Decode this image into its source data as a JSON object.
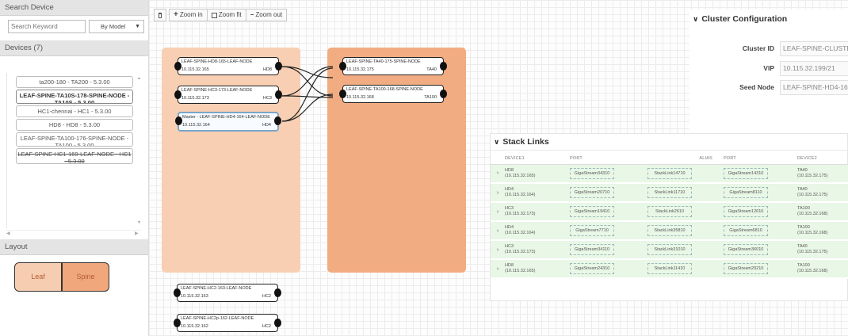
{
  "left_panel": {
    "search_header": "Search Device",
    "search_placeholder": "Search Keyword",
    "model_select": "By Model",
    "devices_header": "Devices (7)",
    "devices": [
      "ta200-180 - TA200 - 5.3.00",
      "LEAF-SPINE-TA10S-178-SPINE-NODE - TA10S - 5.3.00",
      "HC1-chennai - HC1 - 5.3.00",
      "HD8 - HD8 - 5.3.00",
      "LEAF-SPINE-TA100-176-SPINE-NODE - TA100 - 5.3.00",
      "LEAF-SPINE-HC1-169-LEAF-NODE - HC1 - 5.3.00"
    ],
    "layout_header": "Layout",
    "legend": {
      "leaf": "Leaf",
      "spine": "Spine"
    }
  },
  "toolbar": {
    "zoom_in": "Zoom in",
    "zoom_fit": "Zoom fit",
    "zoom_out": "Zoom out"
  },
  "topology": {
    "leaf_nodes": [
      {
        "name": "LEAF-SPINE-HD8-165-LEAF-NODE",
        "ip": "10.115.32.165",
        "model": "HD8"
      },
      {
        "name": "LEAF-SPINE-HC3-173-LEAF-NODE",
        "ip": "10.115.32.173",
        "model": "HC3"
      },
      {
        "name": "Master - LEAF-SPINE-HD4-164-LEAF-NODE",
        "ip": "10.115.32.164",
        "model": "HD4"
      }
    ],
    "spine_nodes": [
      {
        "name": "LEAF-SPINE-TA40-175-SPINE-NODE",
        "ip": "10.115.32.175",
        "model": "TA40"
      },
      {
        "name": "LEAF-SPINE-TA100-168-SPINE-NODE",
        "ip": "10.115.32.168",
        "model": "TA100"
      }
    ],
    "unassigned_nodes": [
      {
        "name": "LEAF-SPINE-HC2-163-LEAF-NODE",
        "ip": "10.115.32.163",
        "model": "HC2"
      },
      {
        "name": "LEAF-SPINE-HC2p-162-LEAF-NODE",
        "ip": "10.115.32.162",
        "model": "HC2"
      }
    ]
  },
  "cluster_config": {
    "title": "Cluster Configuration",
    "cluster_id_label": "Cluster ID",
    "cluster_id": "LEAF-SPINE-CLUSTER-",
    "vip_label": "VIP",
    "vip": "10.115.32.199/21",
    "seed_node_label": "Seed Node",
    "seed_node": "LEAF-SPINE-HD4-164-"
  },
  "stack_links": {
    "title": "Stack Links",
    "columns": [
      "DEVICE1",
      "PORT",
      "ALIAS",
      "PORT",
      "DEVICE2"
    ],
    "rows": [
      {
        "d1": "HD8",
        "d1_ip": "(10.115.32.165)",
        "p1": "GigaStream34310",
        "alias": "StackLink14710",
        "p2": "GigaStream14310",
        "d2": "TA40",
        "d2_ip": "(10.115.32.175)"
      },
      {
        "d1": "HD4",
        "d1_ip": "(10.115.32.164)",
        "p1": "GigaStream20710",
        "alias": "StackLink11710",
        "p2": "GigaStream8110",
        "d2": "TA40",
        "d2_ip": "(10.115.32.175)"
      },
      {
        "d1": "HC3",
        "d1_ip": "(10.115.32.173)",
        "p1": "GigaStream19410",
        "alias": "StackLink2610",
        "p2": "GigaStream12610",
        "d2": "TA100",
        "d2_ip": "(10.115.32.168)"
      },
      {
        "d1": "HD4",
        "d1_ip": "(10.115.32.164)",
        "p1": "GigaStream7710",
        "alias": "StackLink35810",
        "p2": "GigaStream6810",
        "d2": "TA100",
        "d2_ip": "(10.115.32.168)"
      },
      {
        "d1": "HC3",
        "d1_ip": "(10.115.32.173)",
        "p1": "GigaStream34110",
        "alias": "StackLink31010",
        "p2": "GigaStream36010",
        "d2": "TA40",
        "d2_ip": "(10.115.32.175)"
      },
      {
        "d1": "HD8",
        "d1_ip": "(10.115.32.165)",
        "p1": "GigaStream24310",
        "alias": "StackLink11410",
        "p2": "GigaStream29210",
        "d2": "TA100",
        "d2_ip": "(10.115.32.168)"
      }
    ]
  }
}
